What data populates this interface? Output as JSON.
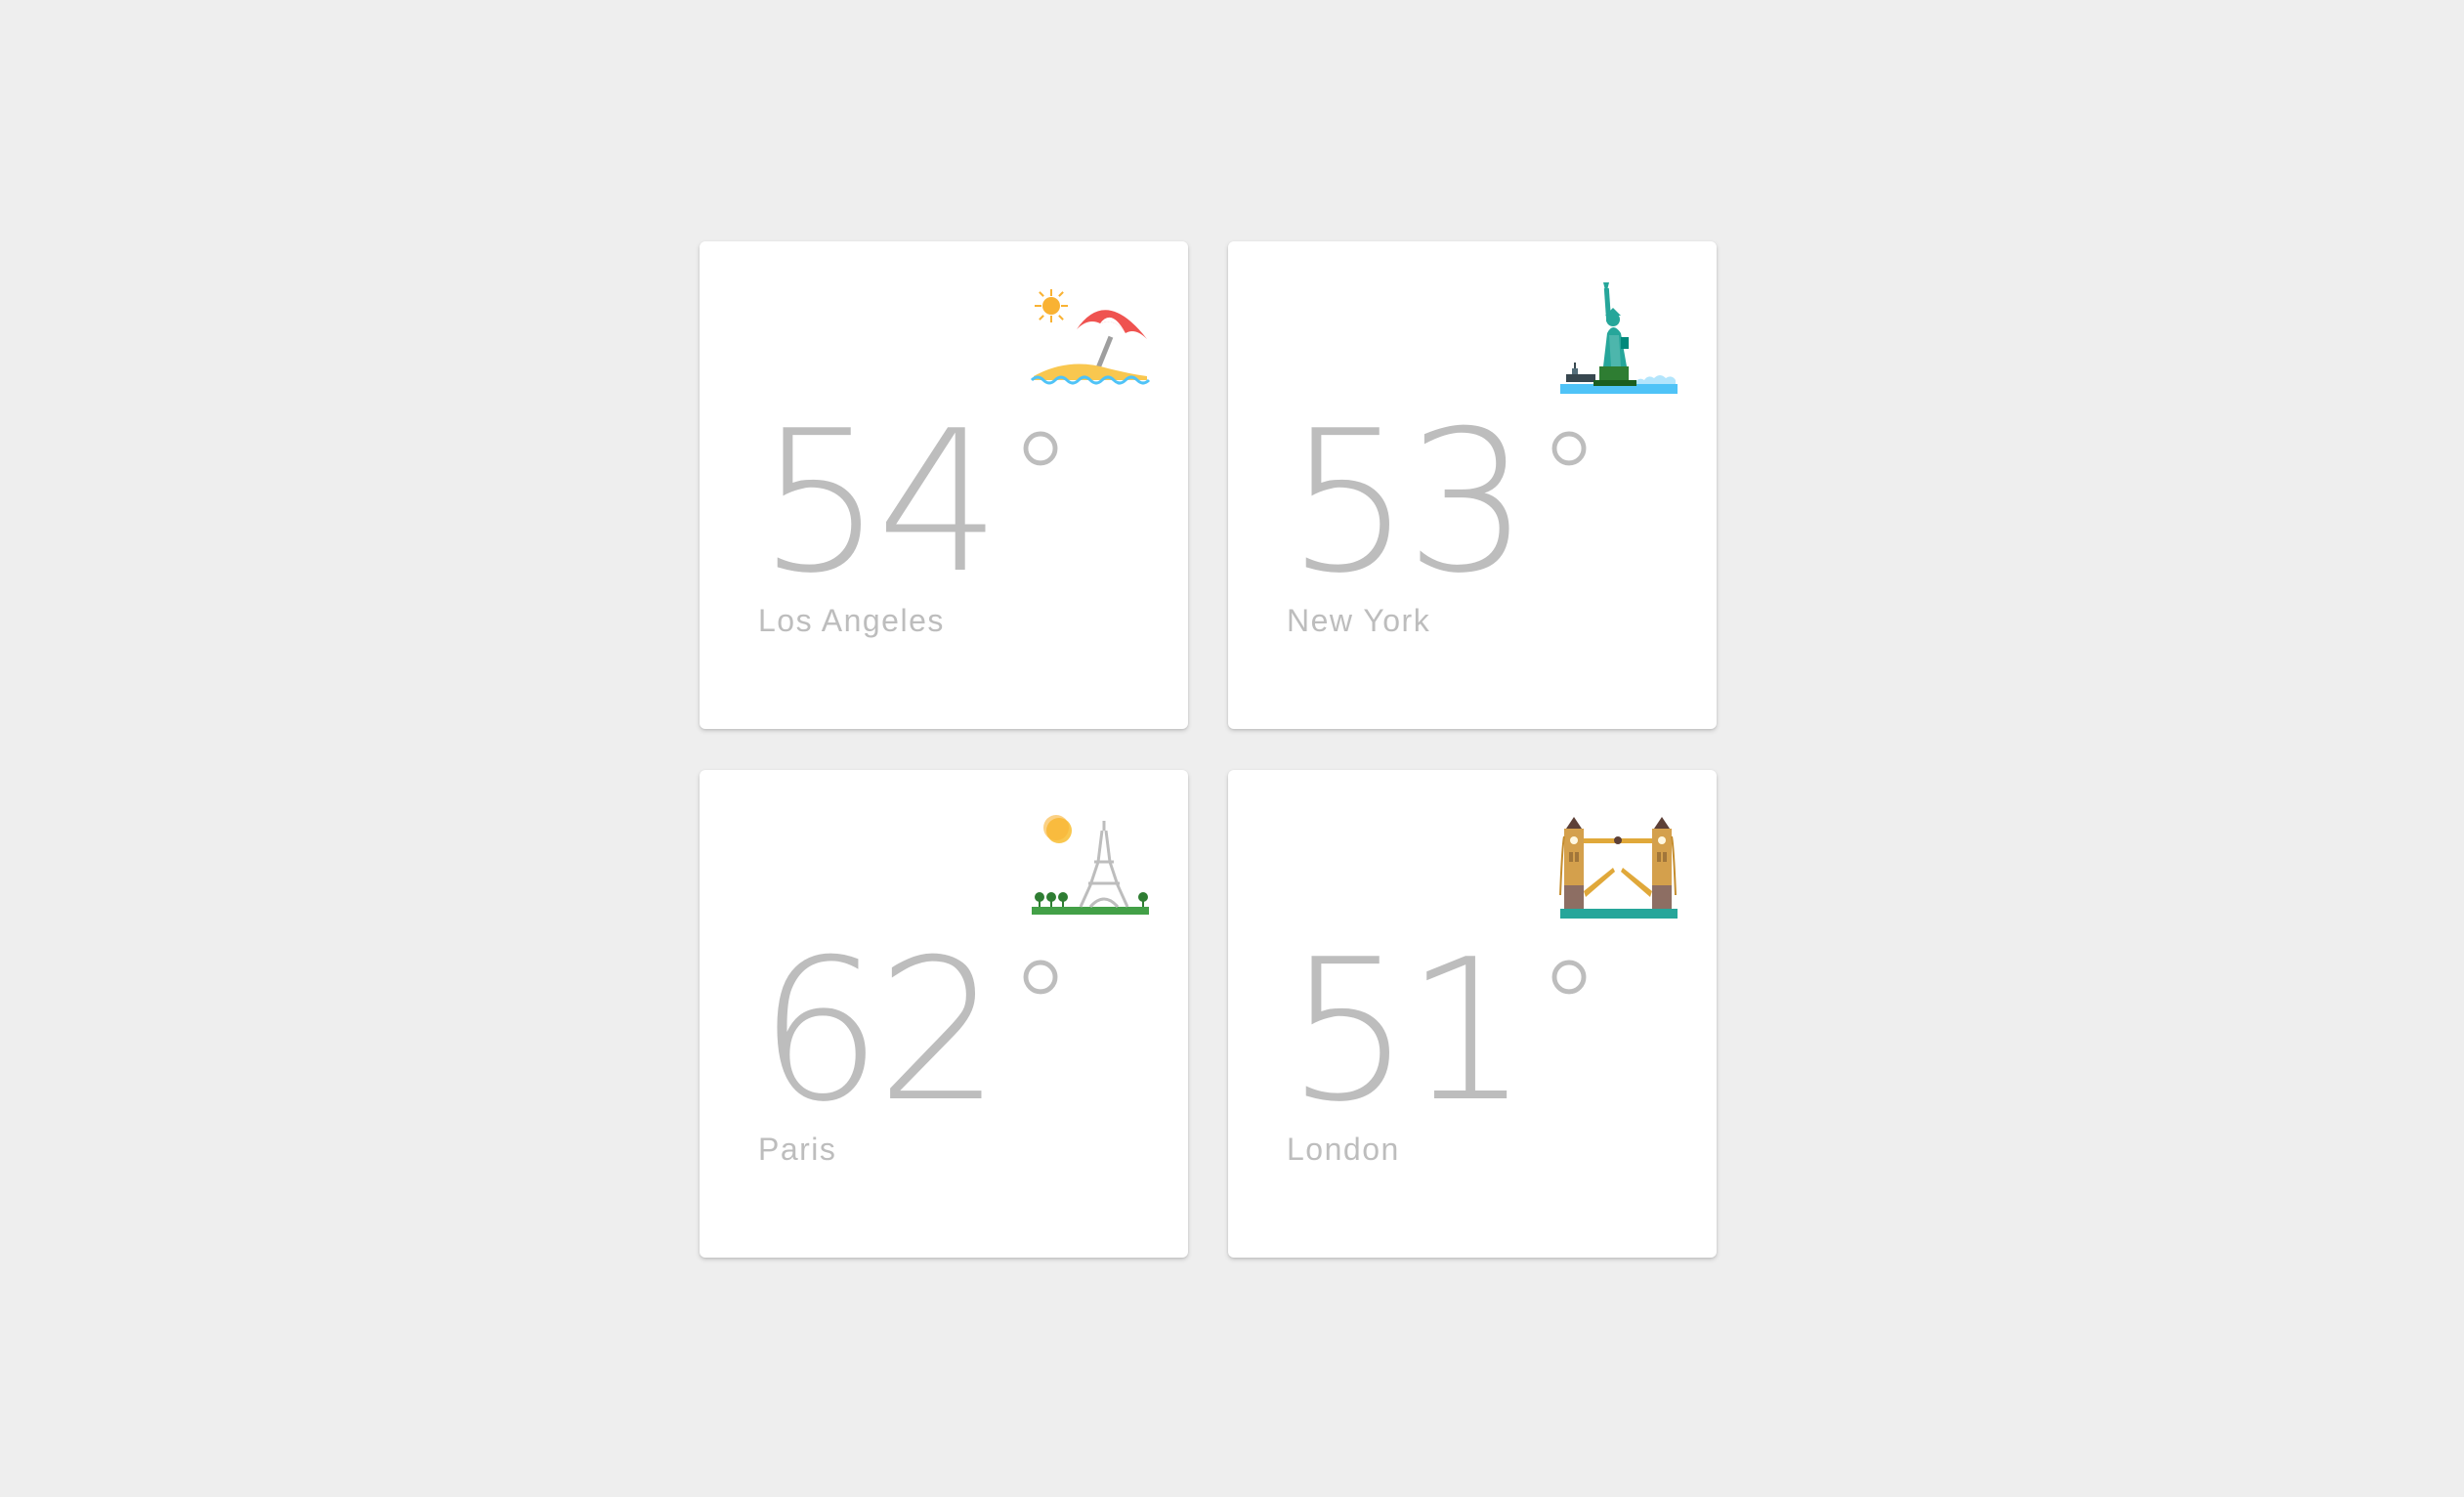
{
  "cards": [
    {
      "temperature": "54",
      "degree_symbol": "°",
      "city": "Los Angeles",
      "illustration": "beach-umbrella-sun-icon"
    },
    {
      "temperature": "53",
      "degree_symbol": "°",
      "city": "New York",
      "illustration": "statue-of-liberty-icon"
    },
    {
      "temperature": "62",
      "degree_symbol": "°",
      "city": "Paris",
      "illustration": "eiffel-tower-icon"
    },
    {
      "temperature": "51",
      "degree_symbol": "°",
      "city": "London",
      "illustration": "tower-bridge-icon"
    }
  ],
  "colors": {
    "background": "#eeeeee",
    "card": "#ffffff",
    "text": "#bdbdbd"
  }
}
